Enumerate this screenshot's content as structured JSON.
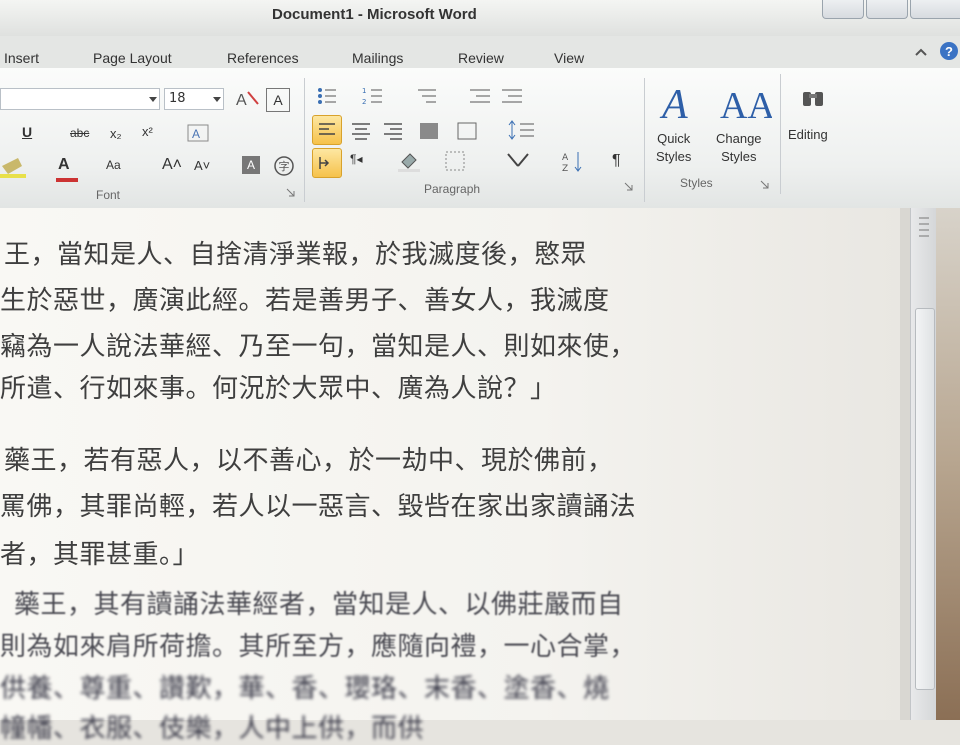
{
  "window": {
    "title": "Document1 - Microsoft Word"
  },
  "tabs": [
    "Insert",
    "Page Layout",
    "References",
    "Mailings",
    "Review",
    "View"
  ],
  "ribbon": {
    "font": {
      "size": "18",
      "group_label": "Font"
    },
    "paragraph": {
      "group_label": "Paragraph"
    },
    "styles": {
      "quick_styles": "Quick\nStyles",
      "change_styles": "Change\nStyles",
      "group_label": "Styles"
    },
    "editing": {
      "label": "Editing"
    }
  },
  "document": {
    "paragraphs": [
      [
        "王，當知是人、自捨清淨業報，於我滅度後，愍眾",
        "生於惡世，廣演此經。若是善男子、善女人，我滅度",
        "竊為一人說法華經、乃至一句，當知是人、則如來使，",
        "所遣、行如來事。何況於大眾中、廣為人說？」"
      ],
      [
        "藥王，若有惡人，以不善心，於一劫中、現於佛前，",
        "罵佛，其罪尚輕，若人以一惡言、毀呰在家出家讀誦法",
        "者，其罪甚重。」"
      ],
      [
        "藥王，其有讀誦法華經者，當知是人、以佛莊嚴而自",
        "則為如來肩所荷擔。其所至方，應隨向禮，一心合掌，",
        "供養、尊重、讚歎，華、香、瓔珞、末香、塗香、燒",
        "幢幡、衣服、伎樂，人中上供，而供"
      ]
    ]
  }
}
